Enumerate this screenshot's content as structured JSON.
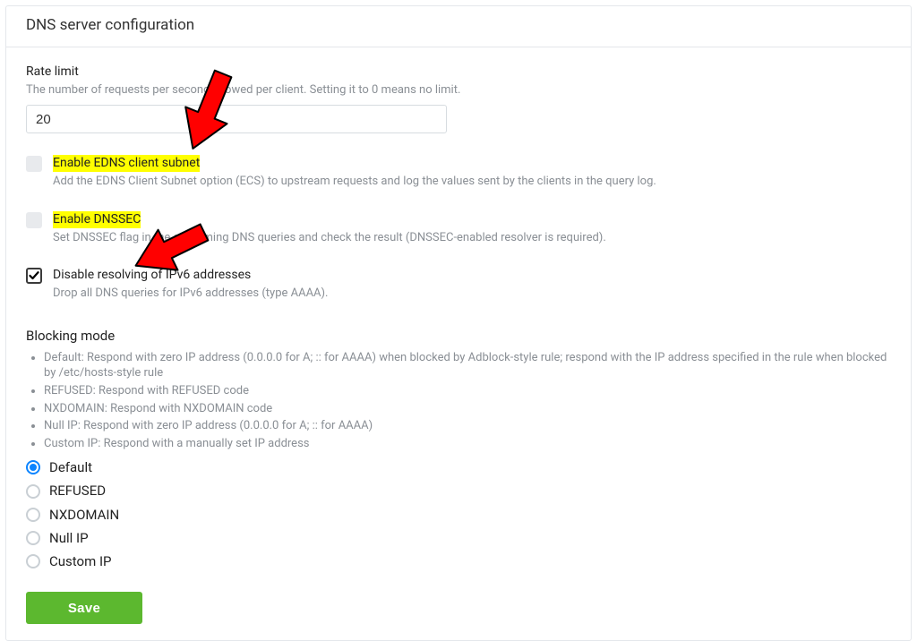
{
  "title": "DNS server configuration",
  "rate_limit": {
    "label": "Rate limit",
    "desc": "The number of requests per second allowed per client. Setting it to 0 means no limit.",
    "value": "20"
  },
  "options": {
    "edns": {
      "label": "Enable EDNS client subnet",
      "desc": "Add the EDNS Client Subnet option (ECS) to upstream requests and log the values sent by the clients in the query log.",
      "checked": false,
      "highlight": true
    },
    "dnssec": {
      "label": "Enable DNSSEC",
      "desc": "Set DNSSEC flag in the outcoming DNS queries and check the result (DNSSEC-enabled resolver is required).",
      "checked": false,
      "highlight": true
    },
    "disable_ipv6": {
      "label": "Disable resolving of IPv6 addresses",
      "desc": "Drop all DNS queries for IPv6 addresses (type AAAA).",
      "checked": true,
      "highlight": false
    }
  },
  "blocking": {
    "heading": "Blocking mode",
    "bullets": [
      "Default: Respond with zero IP address (0.0.0.0 for A; :: for AAAA) when blocked by Adblock-style rule; respond with the IP address specified in the rule when blocked by /etc/hosts-style rule",
      "REFUSED: Respond with REFUSED code",
      "NXDOMAIN: Respond with NXDOMAIN code",
      "Null IP: Respond with zero IP address (0.0.0.0 for A; :: for AAAA)",
      "Custom IP: Respond with a manually set IP address"
    ],
    "modes": [
      {
        "key": "default",
        "label": "Default",
        "selected": true
      },
      {
        "key": "refused",
        "label": "REFUSED",
        "selected": false
      },
      {
        "key": "nxdomain",
        "label": "NXDOMAIN",
        "selected": false
      },
      {
        "key": "nullip",
        "label": "Null IP",
        "selected": false
      },
      {
        "key": "customip",
        "label": "Custom IP",
        "selected": false
      }
    ]
  },
  "save_label": "Save",
  "annotations": {
    "arrow_color": "#ff0000",
    "arrows": [
      {
        "target": "edns"
      },
      {
        "target": "dnssec"
      }
    ]
  }
}
